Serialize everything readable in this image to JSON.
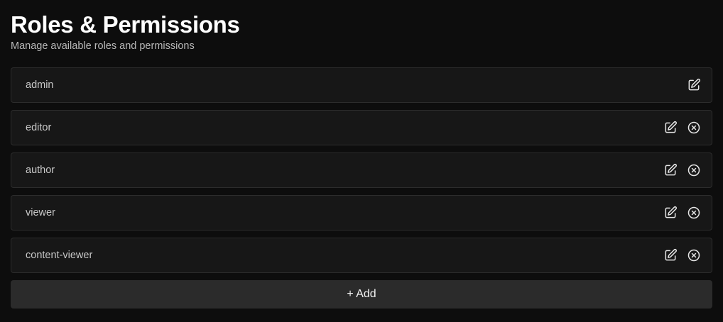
{
  "header": {
    "title": "Roles & Permissions",
    "subtitle": "Manage available roles and permissions"
  },
  "roles": [
    {
      "name": "admin",
      "editable": true,
      "deletable": false
    },
    {
      "name": "editor",
      "editable": true,
      "deletable": true
    },
    {
      "name": "author",
      "editable": true,
      "deletable": true
    },
    {
      "name": "viewer",
      "editable": true,
      "deletable": true
    },
    {
      "name": "content-viewer",
      "editable": true,
      "deletable": true
    }
  ],
  "actions": {
    "add_label": "+ Add"
  },
  "icons": {
    "edit": "edit-icon",
    "delete": "close-circle-icon"
  },
  "colors": {
    "background": "#0d0d0d",
    "row_background": "#171717",
    "row_border": "#2c2c2c",
    "add_button_background": "#2b2b2b",
    "text_primary": "#ffffff",
    "text_secondary": "#b8b8b8"
  }
}
